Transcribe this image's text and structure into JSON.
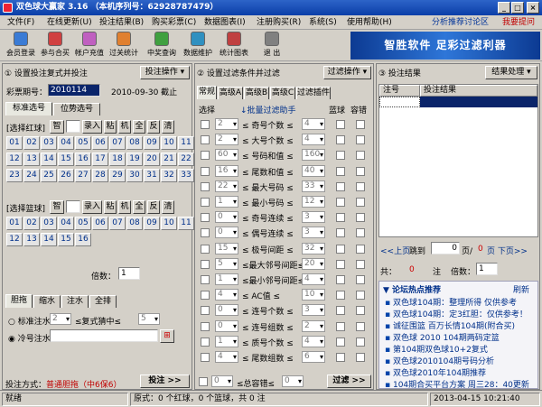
{
  "window": {
    "title": "双色球大赢家 3.16 （本机序列号：62928787479）"
  },
  "menu": [
    "文件(F)",
    "在线更新(U)",
    "投注结果(B)",
    "购买彩票(C)",
    "数据图表(I)",
    "注册购买(R)",
    "系统(S)",
    "使用帮助(H)"
  ],
  "menu_links": {
    "forum": "分析推荐讨论区",
    "recommend": "我要提问"
  },
  "toolbar": [
    {
      "label": "会员登录",
      "icon": "member-icon",
      "color": "#3a7bd5"
    },
    {
      "label": "参与合买",
      "icon": "group-buy-icon",
      "color": "#d04040"
    },
    {
      "label": "帐户充值",
      "icon": "recharge-icon",
      "color": "#c060c0"
    },
    {
      "label": "过关统计",
      "icon": "stats-icon",
      "color": "#e08030"
    },
    {
      "label": "中奖查询",
      "icon": "query-icon",
      "color": "#40a040"
    },
    {
      "label": "数据维护",
      "icon": "data-icon",
      "color": "#3090c0"
    },
    {
      "label": "统计图表",
      "icon": "chart-icon",
      "color": "#c04040"
    },
    {
      "label": "退 出",
      "icon": "exit-icon",
      "color": "#808080"
    }
  ],
  "banner": "智胜软件 足彩过滤利器",
  "panel1": {
    "title": "① 设置投注复式并投注",
    "ops": "投注操作 ▾",
    "period_label": "彩票期号：",
    "period": "2010114",
    "date": "2010-09-30 截止",
    "tabs": [
      "标准选号",
      "位势选号"
    ],
    "red_label": "[选择红球]",
    "blue_label": "[选择篮球]",
    "tools": [
      "智",
      "",
      "录入",
      "粘",
      "机",
      "全",
      "反",
      "清"
    ],
    "red": [
      "01",
      "02",
      "03",
      "04",
      "05",
      "06",
      "07",
      "08",
      "09",
      "10",
      "11",
      "12",
      "13",
      "14",
      "15",
      "16",
      "17",
      "18",
      "19",
      "20",
      "21",
      "22",
      "23",
      "24",
      "25",
      "26",
      "27",
      "28",
      "29",
      "30",
      "31",
      "32",
      "33"
    ],
    "blue": [
      "01",
      "02",
      "03",
      "04",
      "05",
      "06",
      "07",
      "08",
      "09",
      "10",
      "11",
      "12",
      "13",
      "14",
      "15",
      "16"
    ],
    "multiple_label": "倍数：",
    "multiple": "1",
    "bottom_tabs": [
      "胆拖",
      "缩水",
      "注水",
      "全排"
    ],
    "radio1": "标准注水",
    "radio1_val": "2",
    "radio1_tail": "≤复式猜中≤",
    "radio1_val2": "5",
    "radio2": "冷号注水",
    "method_label": "投注方式：",
    "method": "普通胆拖（中6保6）",
    "bet_button": "投注 >>"
  },
  "panel2": {
    "title": "② 设置过滤条件并过滤",
    "ops": "过滤操作 ▾",
    "tabs": [
      "常规",
      "高级A",
      "高级B",
      "高级C",
      "过滤插件"
    ],
    "col_select": "选择",
    "col_batch": "↓批量过滤助手",
    "col_blue": "蓝球",
    "col_fault": "容错",
    "rows": [
      {
        "min": "2",
        "name": "≤ 奇号个数 ≤",
        "max": "4"
      },
      {
        "min": "2",
        "name": "≤ 大号个数 ≤",
        "max": "4"
      },
      {
        "min": "60",
        "name": "≤ 号码和值 ≤",
        "max": "160"
      },
      {
        "min": "16",
        "name": "≤ 尾数和值 ≤",
        "max": "40"
      },
      {
        "min": "22",
        "name": "≤ 最大号码 ≤",
        "max": "33"
      },
      {
        "min": "1",
        "name": "≤ 最小号码 ≤",
        "max": "12"
      },
      {
        "min": "0",
        "name": "≤ 奇号连续 ≤",
        "max": "3"
      },
      {
        "min": "0",
        "name": "≤ 偶号连续 ≤",
        "max": "3"
      },
      {
        "min": "15",
        "name": "≤ 极号间距 ≤",
        "max": "32"
      },
      {
        "min": "5",
        "name": "≤最大邻号间距≤",
        "max": "20"
      },
      {
        "min": "1",
        "name": "≤最小邻号间距≤",
        "max": "4"
      },
      {
        "min": "4",
        "name": "≤ AC值 ≤",
        "max": "10"
      },
      {
        "min": "0",
        "name": "≤ 连号个数 ≤",
        "max": "3"
      },
      {
        "min": "0",
        "name": "≤ 连号组数 ≤",
        "max": "2"
      },
      {
        "min": "1",
        "name": "≤ 质号个数 ≤",
        "max": "4"
      },
      {
        "min": "4",
        "name": "≤ 尾数组数 ≤",
        "max": "6"
      }
    ],
    "total_min": "0",
    "total_label": "≤总容错≤",
    "total_max": "0",
    "filter_button": "过滤 >>"
  },
  "panel3": {
    "title": "③ 投注结果",
    "ops": "结果处理 ▾",
    "col1": "注号",
    "col2": "投注结果",
    "prev": "<<上页",
    "jump": "跳到",
    "page": "0",
    "page_tail": "页/",
    "total_pages": "0",
    "next": "页 下页>>",
    "total_label": "共：",
    "total": "0",
    "unit": "注",
    "mult_label": "倍数：",
    "mult": "1"
  },
  "news": {
    "title": "▼ 论坛热点推荐",
    "refresh": "刷新",
    "items": [
      "双色球104期：整理所得 仅供参考",
      "双色球104期：定3红胆：仅供参考！",
      "诚征围篮 百万长情104期(附合买)",
      "双色球 2010 104期两码定篮",
      "第104期双色球10+2复式",
      "双色球2010104期号码分析",
      "双色球2010年104期推荐",
      "104期合买平台方案 周三28：40更新"
    ]
  },
  "status": {
    "ready": "就绪",
    "info": "原式：0 个红球，0 个篮球，共 0 注",
    "time": "2013-04-15 10:21:40"
  }
}
